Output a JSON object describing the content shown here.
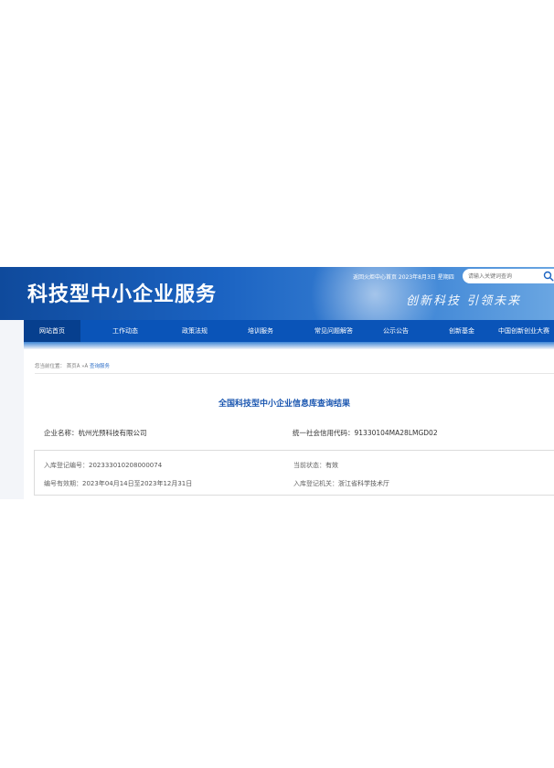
{
  "header": {
    "site_title": "科技型中小企业服务",
    "top_links": "返回火炬中心首页 2023年8月3日 星期四",
    "search_placeholder": "请输入关键词查询",
    "slogan": "创新科技 引领未来"
  },
  "nav": {
    "items": [
      "网站首页",
      "工作动态",
      "政策法规",
      "培训服务",
      "常见问题解答",
      "公示公告",
      "创新基金",
      "中国创新创业大赛"
    ],
    "active_index": 0
  },
  "breadcrumb": {
    "prefix": "您当前位置：",
    "home": "首页Â",
    "separator": "»Â",
    "current": "查询服务"
  },
  "result": {
    "title": "全国科技型中小企业信息库查询结果",
    "company_label": "企业名称：",
    "company_value": "杭州光预科技有限公司",
    "credit_label": "统一社会信用代码：",
    "credit_value": "91330104MA28LMGD02",
    "reg_no_label": "入库登记编号：",
    "reg_no_value": "202333010208000074",
    "status_label": "当前状态：",
    "status_value": "有效",
    "validity_label": "编号有效期：",
    "validity_value": "2023年04月14日至2023年12月31日",
    "authority_label": "入库登记机关：",
    "authority_value": "浙江省科学技术厅"
  },
  "colors": {
    "banner_dark": "#0f4a9c",
    "nav_bg": "#0a54b8",
    "title_blue": "#1a56b0",
    "link_blue": "#2e6fc8"
  },
  "icons": {
    "search": "search-icon"
  }
}
